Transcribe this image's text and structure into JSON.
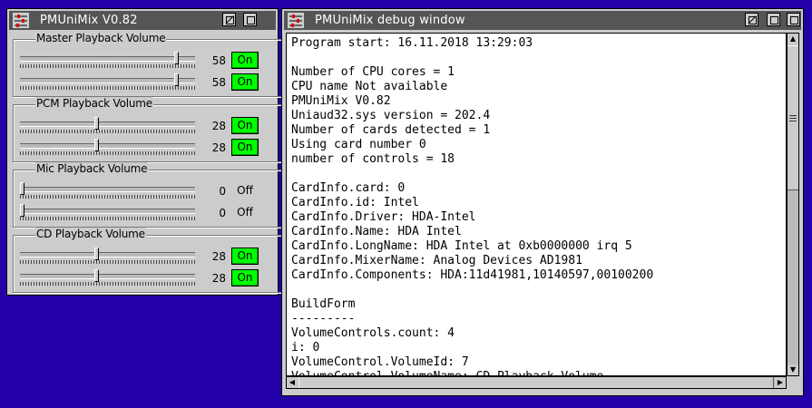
{
  "mixer_window": {
    "title": "PMUniMix V0.82",
    "groups": [
      {
        "label": "Master Playback Volume",
        "channels": [
          {
            "value": "58",
            "level": 58,
            "button": "On",
            "active": true
          },
          {
            "value": "58",
            "level": 58,
            "button": "On",
            "active": true
          }
        ]
      },
      {
        "label": "PCM Playback Volume",
        "channels": [
          {
            "value": "28",
            "level": 28,
            "button": "On",
            "active": true
          },
          {
            "value": "28",
            "level": 28,
            "button": "On",
            "active": true
          }
        ]
      },
      {
        "label": "Mic Playback Volume",
        "channels": [
          {
            "value": "0",
            "level": 0,
            "button": "Off",
            "active": false
          },
          {
            "value": "0",
            "level": 0,
            "button": "Off",
            "active": false
          }
        ]
      },
      {
        "label": "CD Playback Volume",
        "channels": [
          {
            "value": "28",
            "level": 28,
            "button": "On",
            "active": true
          },
          {
            "value": "28",
            "level": 28,
            "button": "On",
            "active": true
          }
        ]
      }
    ]
  },
  "debug_window": {
    "title": "PMUniMix debug window",
    "log_lines": [
      "Program start: 16.11.2018 13:29:03",
      "",
      "Number of CPU cores = 1",
      "CPU name Not available",
      "PMUniMix V0.82",
      "Uniaud32.sys version = 202.4",
      "Number of cards detected = 1",
      "Using card number 0",
      "number of controls = 18",
      "",
      "CardInfo.card: 0",
      "CardInfo.id: Intel",
      "CardInfo.Driver: HDA-Intel",
      "CardInfo.Name: HDA Intel",
      "CardInfo.LongName: HDA Intel at 0xb0000000 irq 5",
      "CardInfo.MixerName: Analog Devices AD1981",
      "CardInfo.Components: HDA:11d41981,10140597,00100200",
      "",
      "BuildForm",
      "---------",
      "VolumeControls.count: 4",
      "i: 0",
      "VolumeControl.VolumeId: 7",
      "VolumeControl.VolumeName: CD Playback Volume"
    ],
    "scroll_fraction": 0.2
  },
  "colors": {
    "desktop": "#2400a8",
    "titlebar": "#555555",
    "on_button": "#00ff00"
  },
  "icons": {
    "system_menu": "mixer-sliders-icon",
    "minimize": "minimize-icon",
    "maximize": "maximize-icon"
  }
}
